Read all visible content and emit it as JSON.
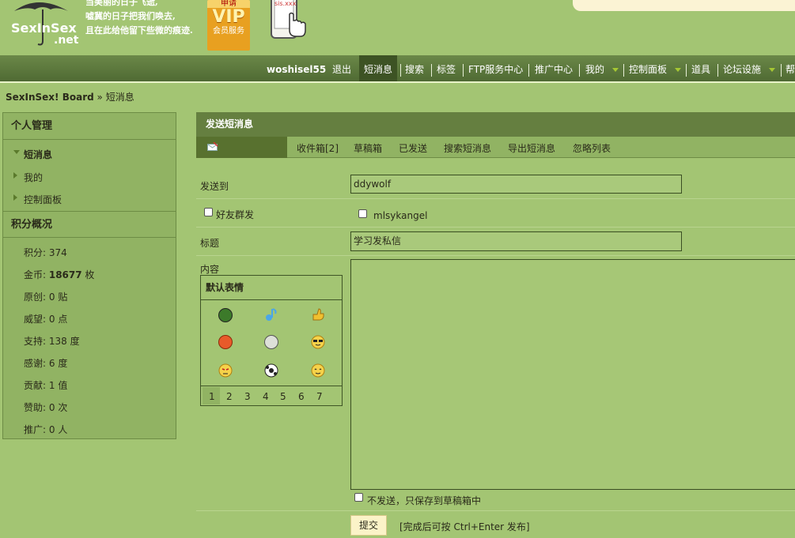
{
  "header": {
    "logo_text": "SexInSex",
    "logo_sub": ".net",
    "slogan_lines": [
      "当美丽的日子飞逝,",
      "嘘冀的日子把我们唤去,",
      "且在此给他留下些微的痕迹."
    ],
    "vip_top": "申请",
    "vip_big": "VIP",
    "vip_sub": "会员服务",
    "phone_label": "sis.xxx"
  },
  "nav": {
    "username": "woshisel55",
    "logout": "退出",
    "items": [
      "短消息",
      "搜索",
      "标签",
      "FTP服务中心",
      "推广中心",
      "我的",
      "控制面板",
      "道具",
      "论坛设施",
      "帮"
    ]
  },
  "breadcrumb": {
    "board": "SexInSex! Board",
    "sep": "»",
    "current": "短消息"
  },
  "sidebar": {
    "personal_title": "个人管理",
    "items": [
      "短消息",
      "我的",
      "控制面板"
    ],
    "points_title": "积分概况",
    "stats": [
      {
        "label": "积分: ",
        "value": "374",
        "unit": ""
      },
      {
        "label": "金币: ",
        "value": "18677",
        "unit": " 枚"
      },
      {
        "label": "原创: ",
        "value": "0",
        "unit": " 贴"
      },
      {
        "label": "威望: ",
        "value": "0",
        "unit": " 点"
      },
      {
        "label": "支持: ",
        "value": "138",
        "unit": " 度"
      },
      {
        "label": "感谢: ",
        "value": "6",
        "unit": " 度"
      },
      {
        "label": "贡献: ",
        "value": "1",
        "unit": " 值"
      },
      {
        "label": "赞助: ",
        "value": "0",
        "unit": " 次"
      },
      {
        "label": "推广: ",
        "value": "0",
        "unit": " 人"
      }
    ]
  },
  "main": {
    "title": "发送短消息",
    "tabs": [
      "收件箱[2]",
      "草稿箱",
      "已发送",
      "搜索短消息",
      "导出短消息",
      "忽略列表"
    ],
    "send_to_label": "发送到",
    "send_to_value": "ddywolf",
    "group_label": "好友群发",
    "friend_name": "mlsykangel",
    "subject_label": "标题",
    "subject_value": "学习发私信",
    "content_label": "内容",
    "smiley_title": "默认表情",
    "smiley_pages": [
      "1",
      "2",
      "3",
      "4",
      "5",
      "6",
      "7"
    ],
    "draft_label": "不发送，只保存到草稿箱中",
    "submit_label": "提交",
    "hint": "[完成后可按 Ctrl+Enter 发布]"
  },
  "colors": {
    "background": "#a3c573",
    "nav": "#5a7539",
    "header_bar": "#657f40",
    "submit_bg": "#fbf3c8"
  },
  "icons": [
    "umbrella-logo-icon",
    "phone-hand-icon",
    "compose-icon",
    "emoticon-icons"
  ]
}
